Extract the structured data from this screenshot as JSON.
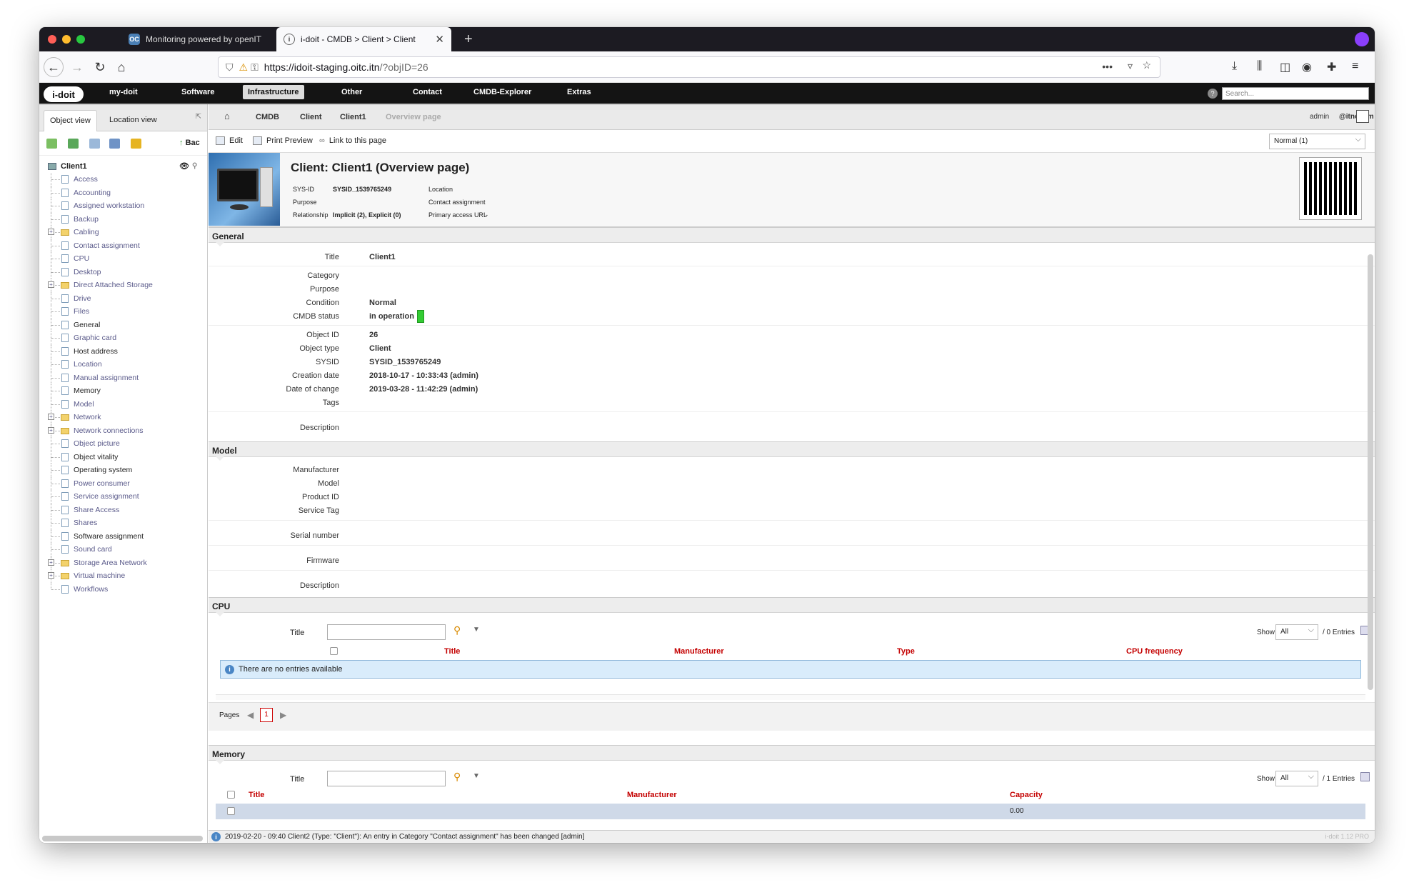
{
  "browser": {
    "tabs": [
      {
        "label": "Monitoring powered by openIT",
        "favicon": "OC"
      },
      {
        "label": "i-doit - CMDB > Client > Client",
        "favicon": "i"
      }
    ],
    "url_host": "https://idoit-staging.oitc.itn",
    "url_path": "/?objID=26"
  },
  "topmenu": {
    "logo": "i-doit",
    "items": [
      "my-doit",
      "Software",
      "Infrastructure",
      "Other",
      "Contact",
      "CMDB-Explorer",
      "Extras"
    ],
    "active": "Infrastructure",
    "search_placeholder": "Search..."
  },
  "sidebar": {
    "tabs": [
      "Object view",
      "Location view"
    ],
    "back_label": "Bac",
    "root": "Client1",
    "items": [
      {
        "label": "Access",
        "folder": false,
        "dark": false
      },
      {
        "label": "Accounting",
        "folder": false,
        "dark": false
      },
      {
        "label": "Assigned workstation",
        "folder": false,
        "dark": false
      },
      {
        "label": "Backup",
        "folder": false,
        "dark": false
      },
      {
        "label": "Cabling",
        "folder": true,
        "dark": false
      },
      {
        "label": "Contact assignment",
        "folder": false,
        "dark": false
      },
      {
        "label": "CPU",
        "folder": false,
        "dark": false
      },
      {
        "label": "Desktop",
        "folder": false,
        "dark": false
      },
      {
        "label": "Direct Attached Storage",
        "folder": true,
        "dark": false
      },
      {
        "label": "Drive",
        "folder": false,
        "dark": false
      },
      {
        "label": "Files",
        "folder": false,
        "dark": false
      },
      {
        "label": "General",
        "folder": false,
        "dark": true
      },
      {
        "label": "Graphic card",
        "folder": false,
        "dark": false
      },
      {
        "label": "Host address",
        "folder": false,
        "dark": true
      },
      {
        "label": "Location",
        "folder": false,
        "dark": false
      },
      {
        "label": "Manual assignment",
        "folder": false,
        "dark": false
      },
      {
        "label": "Memory",
        "folder": false,
        "dark": true
      },
      {
        "label": "Model",
        "folder": false,
        "dark": false
      },
      {
        "label": "Network",
        "folder": true,
        "dark": false
      },
      {
        "label": "Network connections",
        "folder": true,
        "dark": false
      },
      {
        "label": "Object picture",
        "folder": false,
        "dark": false
      },
      {
        "label": "Object vitality",
        "folder": false,
        "dark": true
      },
      {
        "label": "Operating system",
        "folder": false,
        "dark": true
      },
      {
        "label": "Power consumer",
        "folder": false,
        "dark": false
      },
      {
        "label": "Service assignment",
        "folder": false,
        "dark": false
      },
      {
        "label": "Share Access",
        "folder": false,
        "dark": false
      },
      {
        "label": "Shares",
        "folder": false,
        "dark": false
      },
      {
        "label": "Software assignment",
        "folder": false,
        "dark": true
      },
      {
        "label": "Sound card",
        "folder": false,
        "dark": false
      },
      {
        "label": "Storage Area Network",
        "folder": true,
        "dark": false
      },
      {
        "label": "Virtual machine",
        "folder": true,
        "dark": false
      },
      {
        "label": "Workflows",
        "folder": false,
        "dark": false
      }
    ]
  },
  "breadcrumb": [
    "CMDB",
    "Client",
    "Client1",
    "Overview page"
  ],
  "user": {
    "name": "admin",
    "tenant": "@itnovum"
  },
  "actions": {
    "edit": "Edit",
    "print": "Print Preview",
    "link": "Link to this page",
    "view_select": "Normal (1)"
  },
  "header": {
    "title": "Client: Client1 (Overview page)",
    "sysid_label": "SYS-ID",
    "sysid": "SYSID_1539765249",
    "purpose_label": "Purpose",
    "relationship_label": "Relationship",
    "relationship": "Implicit (2), Explicit (0)",
    "location_label": "Location",
    "contact_label": "Contact assignment",
    "access_label": "Primary access URL",
    "access": "-"
  },
  "general": {
    "title": "General",
    "fields": {
      "title_label": "Title",
      "title": "Client1",
      "category_label": "Category",
      "purpose_label": "Purpose",
      "condition_label": "Condition",
      "condition": "Normal",
      "cmdb_label": "CMDB status",
      "cmdb": "in operation",
      "objid_label": "Object ID",
      "objid": "26",
      "objtype_label": "Object type",
      "objtype": "Client",
      "sysid_label": "SYSID",
      "sysid": "SYSID_1539765249",
      "created_label": "Creation date",
      "created": "2018-10-17 - 10:33:43 (admin)",
      "changed_label": "Date of change",
      "changed": "2019-03-28 - 11:42:29 (admin)",
      "tags_label": "Tags",
      "desc_label": "Description"
    },
    "status_color": "#33cc33"
  },
  "model": {
    "title": "Model",
    "labels": [
      "Manufacturer",
      "Model",
      "Product ID",
      "Service Tag",
      "Serial number",
      "Firmware",
      "Description"
    ]
  },
  "cpu": {
    "title": "CPU",
    "filter_label": "Title",
    "show_label": "Show",
    "show_value": "All",
    "entries": "/ 0 Entries",
    "columns": [
      "Title",
      "Manufacturer",
      "Type",
      "CPU frequency"
    ],
    "empty": "There are no entries available",
    "pages_label": "Pages",
    "page": "1"
  },
  "memory": {
    "title": "Memory",
    "filter_label": "Title",
    "show_label": "Show",
    "show_value": "All",
    "entries": "/ 1 Entries",
    "columns": [
      "Title",
      "Manufacturer",
      "Capacity"
    ],
    "row_capacity": "0.00"
  },
  "statusbar": {
    "message": "2019-02-20 - 09:40 Client2 (Type: \"Client\"): An entry in Category \"Contact assignment\" has been changed [admin]",
    "version": "i-doit 1.12 PRO"
  }
}
